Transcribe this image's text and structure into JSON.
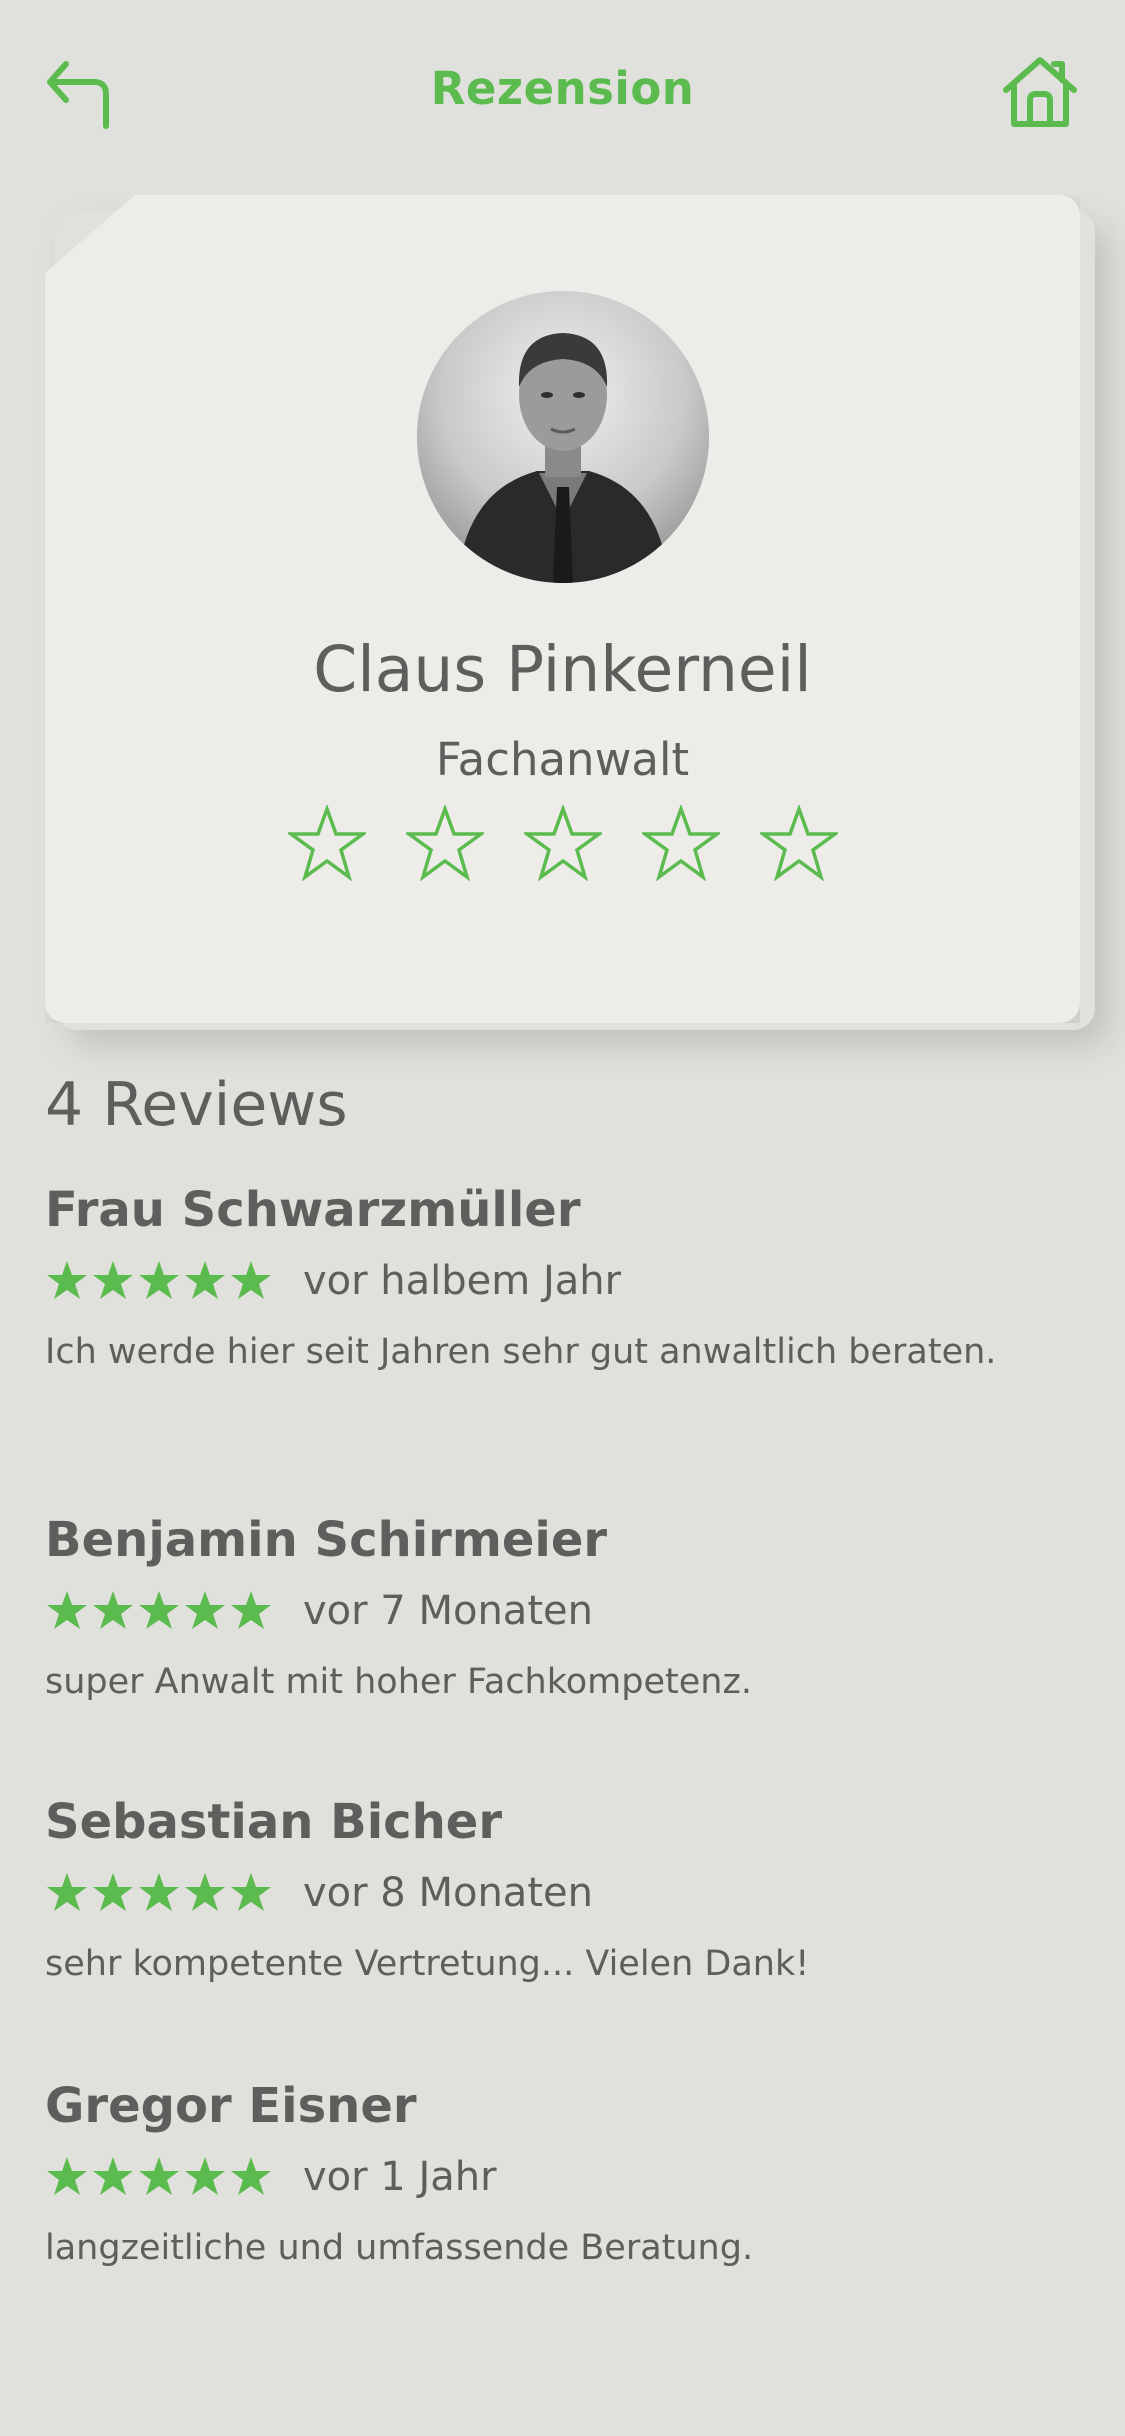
{
  "header": {
    "title": "Rezension",
    "back_icon": "back-arrow-icon",
    "home_icon": "home-icon"
  },
  "colors": {
    "accent": "#5bbb4f",
    "background": "#e0e0dc",
    "card": "#edece8",
    "text": "#5e5e5c"
  },
  "profile": {
    "name": "Claus Pinkerneil",
    "role": "Fachanwalt",
    "rating_stars_total": 5,
    "rating_stars_filled": 0
  },
  "reviews_heading": "4 Reviews",
  "reviews": [
    {
      "author": "Frau Schwarzmüller",
      "stars": 5,
      "time": "vor halbem Jahr",
      "text": "Ich werde hier seit Jahren sehr gut anwaltlich beraten."
    },
    {
      "author": "Benjamin Schirmeier",
      "stars": 5,
      "time": "vor 7 Monaten",
      "text": "super Anwalt mit hoher Fachkompetenz."
    },
    {
      "author": "Sebastian Bicher",
      "stars": 5,
      "time": "vor 8 Monaten",
      "text": "sehr kompetente Vertretung... Vielen Dank!"
    },
    {
      "author": "Gregor Eisner",
      "stars": 5,
      "time": "vor 1 Jahr",
      "text": "langzeitliche und umfassende Beratung."
    }
  ]
}
